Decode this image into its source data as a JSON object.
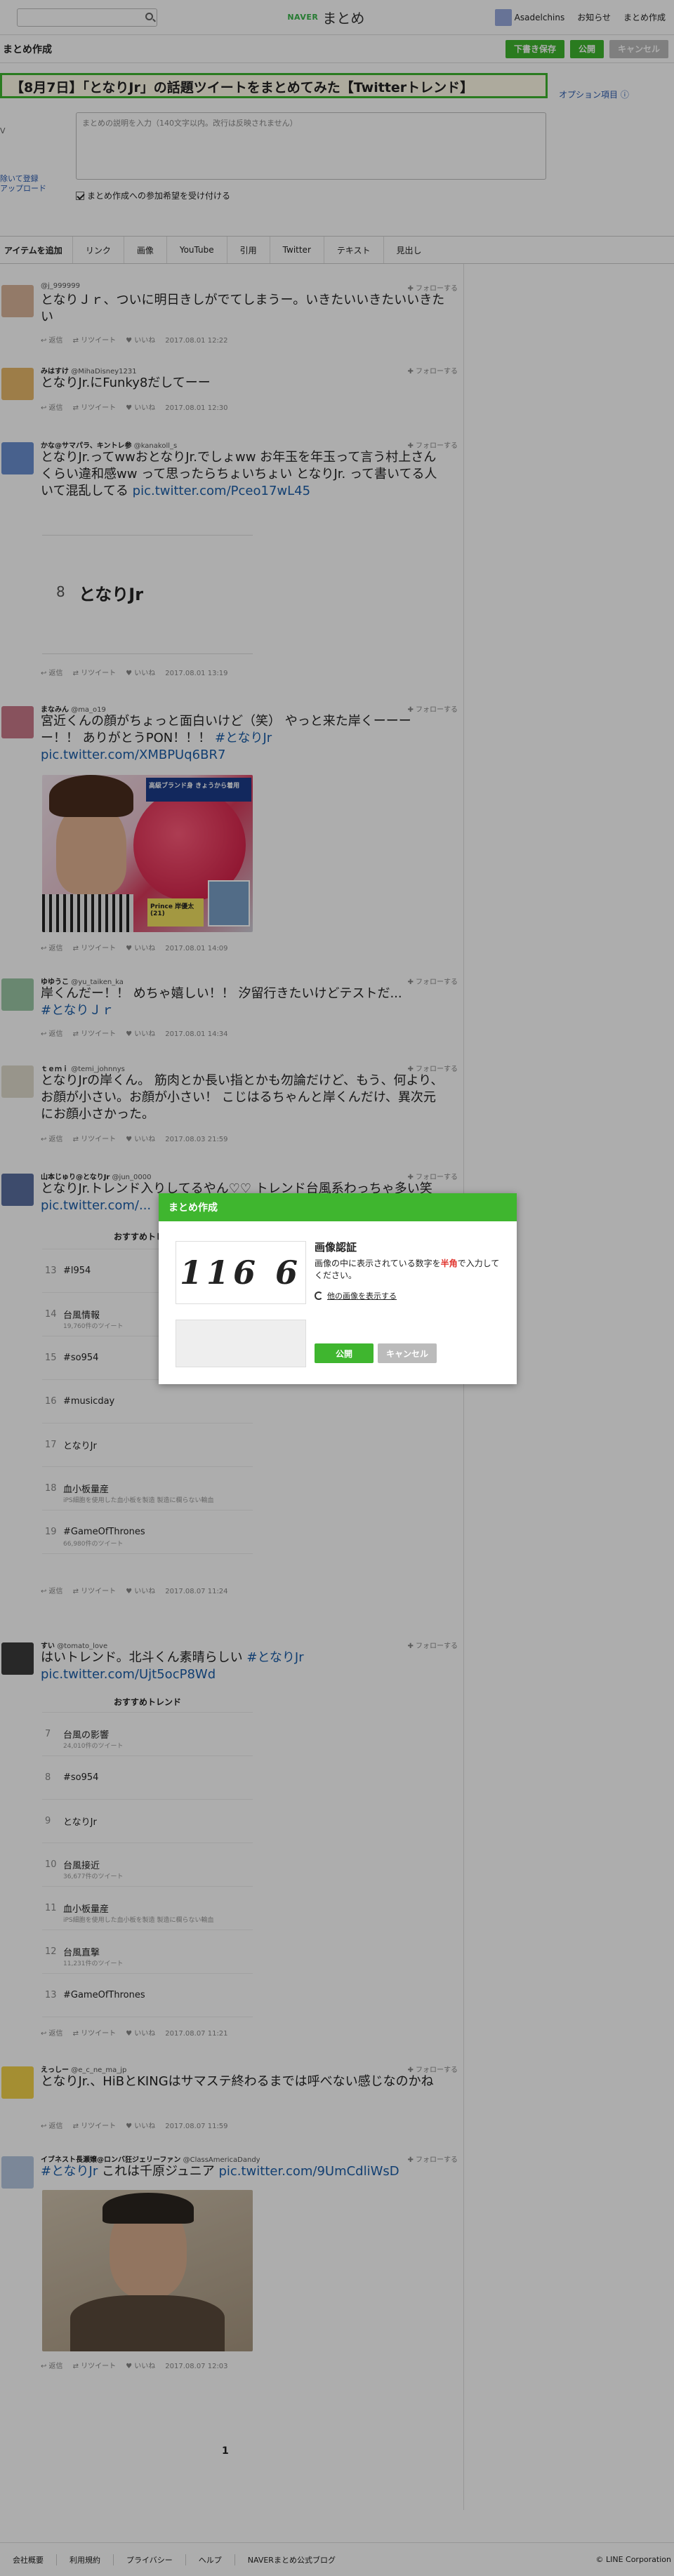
{
  "gnav": {
    "brand_naver": "NAVER",
    "brand_matome": "まとめ",
    "username": "Asadelchins",
    "notices": "お知らせ",
    "create": "まとめ作成"
  },
  "header": {
    "title": "まとめ作成",
    "save_draft": "下書き保存",
    "publish": "公開",
    "cancel": "キャンセル"
  },
  "editor": {
    "title_value": "【8月7日】「となりJr」の話題ツイートをまとめてみた【Twitterトレンド】",
    "option_link": "オプション項目 ⓘ",
    "desc_placeholder": "まとめの説明を入力（140文字以内。改行は反映されません）",
    "side_tag": "V",
    "side_link1": "除いて登録",
    "side_link2": "アップロード",
    "collab_label": "まとめ作成への参加希望を受け付ける"
  },
  "toolbar": {
    "label": "アイテムを追加",
    "tabs": [
      "リンク",
      "画像",
      "YouTube",
      "引用",
      "Twitter",
      "テキスト",
      "見出し"
    ]
  },
  "tweet_actions": {
    "reply": "返信",
    "retweet": "リツイート",
    "like": "いいね",
    "follow": "フォローする"
  },
  "tweets": [
    {
      "name": "",
      "handle": "@j_999999",
      "text": "となりＪｒ、ついに明日きしがでてしまうー。いきたいいきたいいきたい",
      "time": "2017.08.01 12:22"
    },
    {
      "name": "みはすけ",
      "handle": "@MihaDisney1231",
      "text": "となりJr.にFunky8だしてーー",
      "time": "2017.08.01 12:30"
    },
    {
      "name": "かな@サマパラ、キントレ参",
      "handle": "@kanakoll_s",
      "text_a": "となりJr.ってwwおとなりJr.でしょww お年玉を年玉って言う村上さんくらい違和感ww って思ったらちょいちょい となりJr. って書いてる人いて混乱してる ",
      "link": "pic.twitter.com/Pceo17wL45",
      "embed_num": "8",
      "embed_label": "となりJr",
      "time": "2017.08.01 13:19"
    },
    {
      "name": "まなみん",
      "handle": "@ma_o19",
      "text_a": "宮近くんの顔がちょっと面白いけど（笑） やっと来た岸くーーーー！！ ありがとうPON！！！ ",
      "tag": "#となりJr",
      "link": "pic.twitter.com/XMBPUq6BR7",
      "time": "2017.08.01 14:09"
    },
    {
      "name": "ゆゆうこ",
      "handle": "@yu_taiken_ka",
      "text_a": "岸くんだー！！ めちゃ嬉しい！！ 汐留行きたいけどテストだ... ",
      "tag": "#となりＪｒ",
      "time": "2017.08.01 14:34"
    },
    {
      "name": "ｔｅｍｉ",
      "handle": "@temi_johnnys",
      "text": "となりJrの岸くん。 筋肉とか長い指とかも勿論だけど、もう、何より、お顔が小さい。お顔が小さい！ こじはるちゃんと岸くんだけ、異次元にお顔小さかった。",
      "time": "2017.08.03 21:59"
    },
    {
      "name": "山本じゅり@となりJr",
      "handle": "@jun_0000",
      "text_a": "となりJr.トレンド入りしてるやん♡♡ トレンド台風系わっちゃ多い笑 ",
      "link": "pic.twitter.com/...",
      "time": "2017.08.07 11:24"
    },
    {
      "name": "すい",
      "handle": "@tomato_love",
      "text_a": "はいトレンド。北斗くん素晴らしい ",
      "tag": "#となりJr",
      "link": "pic.twitter.com/Ujt5ocP8Wd",
      "time": "2017.08.07 11:21"
    },
    {
      "name": "えっしー",
      "handle": "@e_c_ne_ma_jp",
      "text": "となりJr.、HiBとKINGはサマステ終わるまでは呼べない感じなのかね",
      "time": "2017.08.07 11:59"
    },
    {
      "name": "イブネスト長瀬嬢@ロンバ狂ジェリーファン",
      "handle": "@ClassAmericaDandy",
      "tag": "#となりJr",
      "text_a": " これは千原ジュニア ",
      "link": "pic.twitter.com/9UmCdliWsD",
      "time": "2017.08.07 12:03"
    }
  ],
  "photo_caption": {
    "line1": "高級ブランド身 きょうから着用",
    "name": "Prince 岸優太(21)"
  },
  "trend_frame_a": {
    "header": "おすすめトレンド",
    "rows": [
      {
        "n": "13",
        "t": "#l954",
        "s": ""
      },
      {
        "n": "14",
        "t": "台風情報",
        "s": "19,760件のツイート"
      },
      {
        "n": "15",
        "t": "#so954",
        "s": ""
      },
      {
        "n": "16",
        "t": "#musicday",
        "s": ""
      },
      {
        "n": "17",
        "t": "となりJr",
        "s": ""
      },
      {
        "n": "18",
        "t": "血小板量産",
        "s": "iPS細胞を使用した血小板を製造 製造に欄らない輸血"
      },
      {
        "n": "19",
        "t": "#GameOfThrones",
        "s": "66,980件のツイート"
      }
    ]
  },
  "trend_frame_b": {
    "header": "おすすめトレンド",
    "rows": [
      {
        "n": "7",
        "t": "台風の影響",
        "s": "24,010件のツイート"
      },
      {
        "n": "8",
        "t": "#so954",
        "s": ""
      },
      {
        "n": "9",
        "t": "となりJr",
        "s": ""
      },
      {
        "n": "10",
        "t": "台風接近",
        "s": "36,677件のツイート"
      },
      {
        "n": "11",
        "t": "血小板量産",
        "s": "iPS細胞を使用した血小板を製造 製造に欄らない輸血"
      },
      {
        "n": "12",
        "t": "台風直撃",
        "s": "11,231件のツイート"
      },
      {
        "n": "13",
        "t": "#GameOfThrones",
        "s": ""
      }
    ]
  },
  "pager": {
    "current": "1"
  },
  "modal": {
    "header": "まとめ作成",
    "captcha_text": "116 6",
    "title": "画像認証",
    "desc_a": "画像の中に表示されている数字を",
    "desc_red": "半角",
    "desc_b": "で入力してください。",
    "other_image": "他の画像を表示する",
    "publish": "公開",
    "cancel": "キャンセル"
  },
  "footer": {
    "links": [
      "会社概要",
      "利用規約",
      "プライバシー",
      "ヘルプ",
      "NAVERまとめ公式ブログ"
    ],
    "copyright": "© LINE Corporation"
  }
}
